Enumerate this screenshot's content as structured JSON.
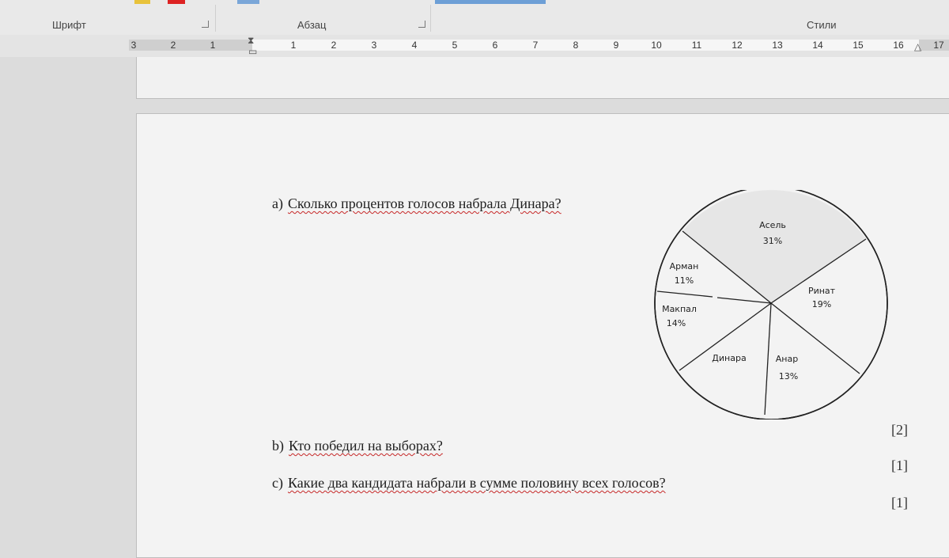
{
  "ribbon": {
    "groups": [
      {
        "label": "Шрифт"
      },
      {
        "label": "Абзац"
      },
      {
        "label": "Стили"
      }
    ]
  },
  "ruler": {
    "left_numbers": [
      "3",
      "2",
      "1"
    ],
    "right_numbers": [
      "1",
      "2",
      "3",
      "4",
      "5",
      "6",
      "7",
      "8",
      "9",
      "10",
      "11",
      "12",
      "13",
      "14",
      "15",
      "16",
      "17"
    ]
  },
  "questions": [
    {
      "label": "a)",
      "text": "Сколько процентов голосов набрала Динара?",
      "marks": "[2]"
    },
    {
      "label": "b)",
      "text": "Кто победил на выборах?",
      "marks": "[1]"
    },
    {
      "label": "c)",
      "text": "Какие два кандидата набрали в сумме половину всех голосов?",
      "marks": "[1]"
    }
  ],
  "chart_data": {
    "type": "pie",
    "title": "",
    "slices": [
      {
        "name": "Асель",
        "value": "31%"
      },
      {
        "name": "Ринат",
        "value": "19%"
      },
      {
        "name": "Анар",
        "value": "13%"
      },
      {
        "name": "Динара",
        "value": ""
      },
      {
        "name": "Макпал",
        "value": "14%"
      },
      {
        "name": "Арман",
        "value": "11%"
      }
    ]
  }
}
